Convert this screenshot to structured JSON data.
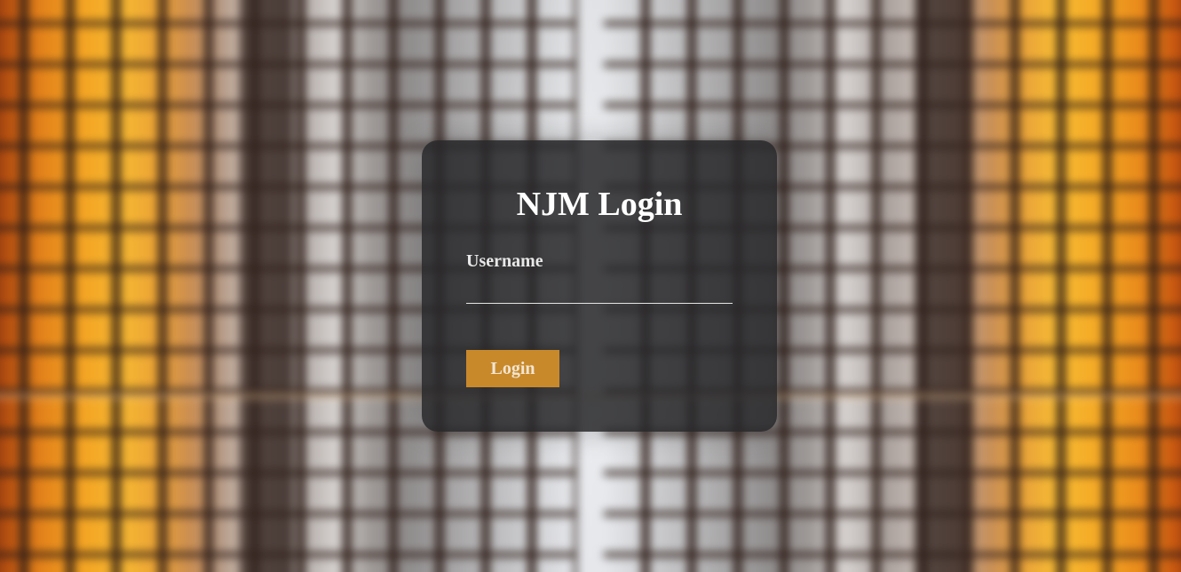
{
  "login": {
    "title": "NJM Login",
    "username_label": "Username",
    "username_value": "",
    "login_button": "Login"
  },
  "colors": {
    "accent": "#c8892b",
    "card_background": "#28282a"
  }
}
